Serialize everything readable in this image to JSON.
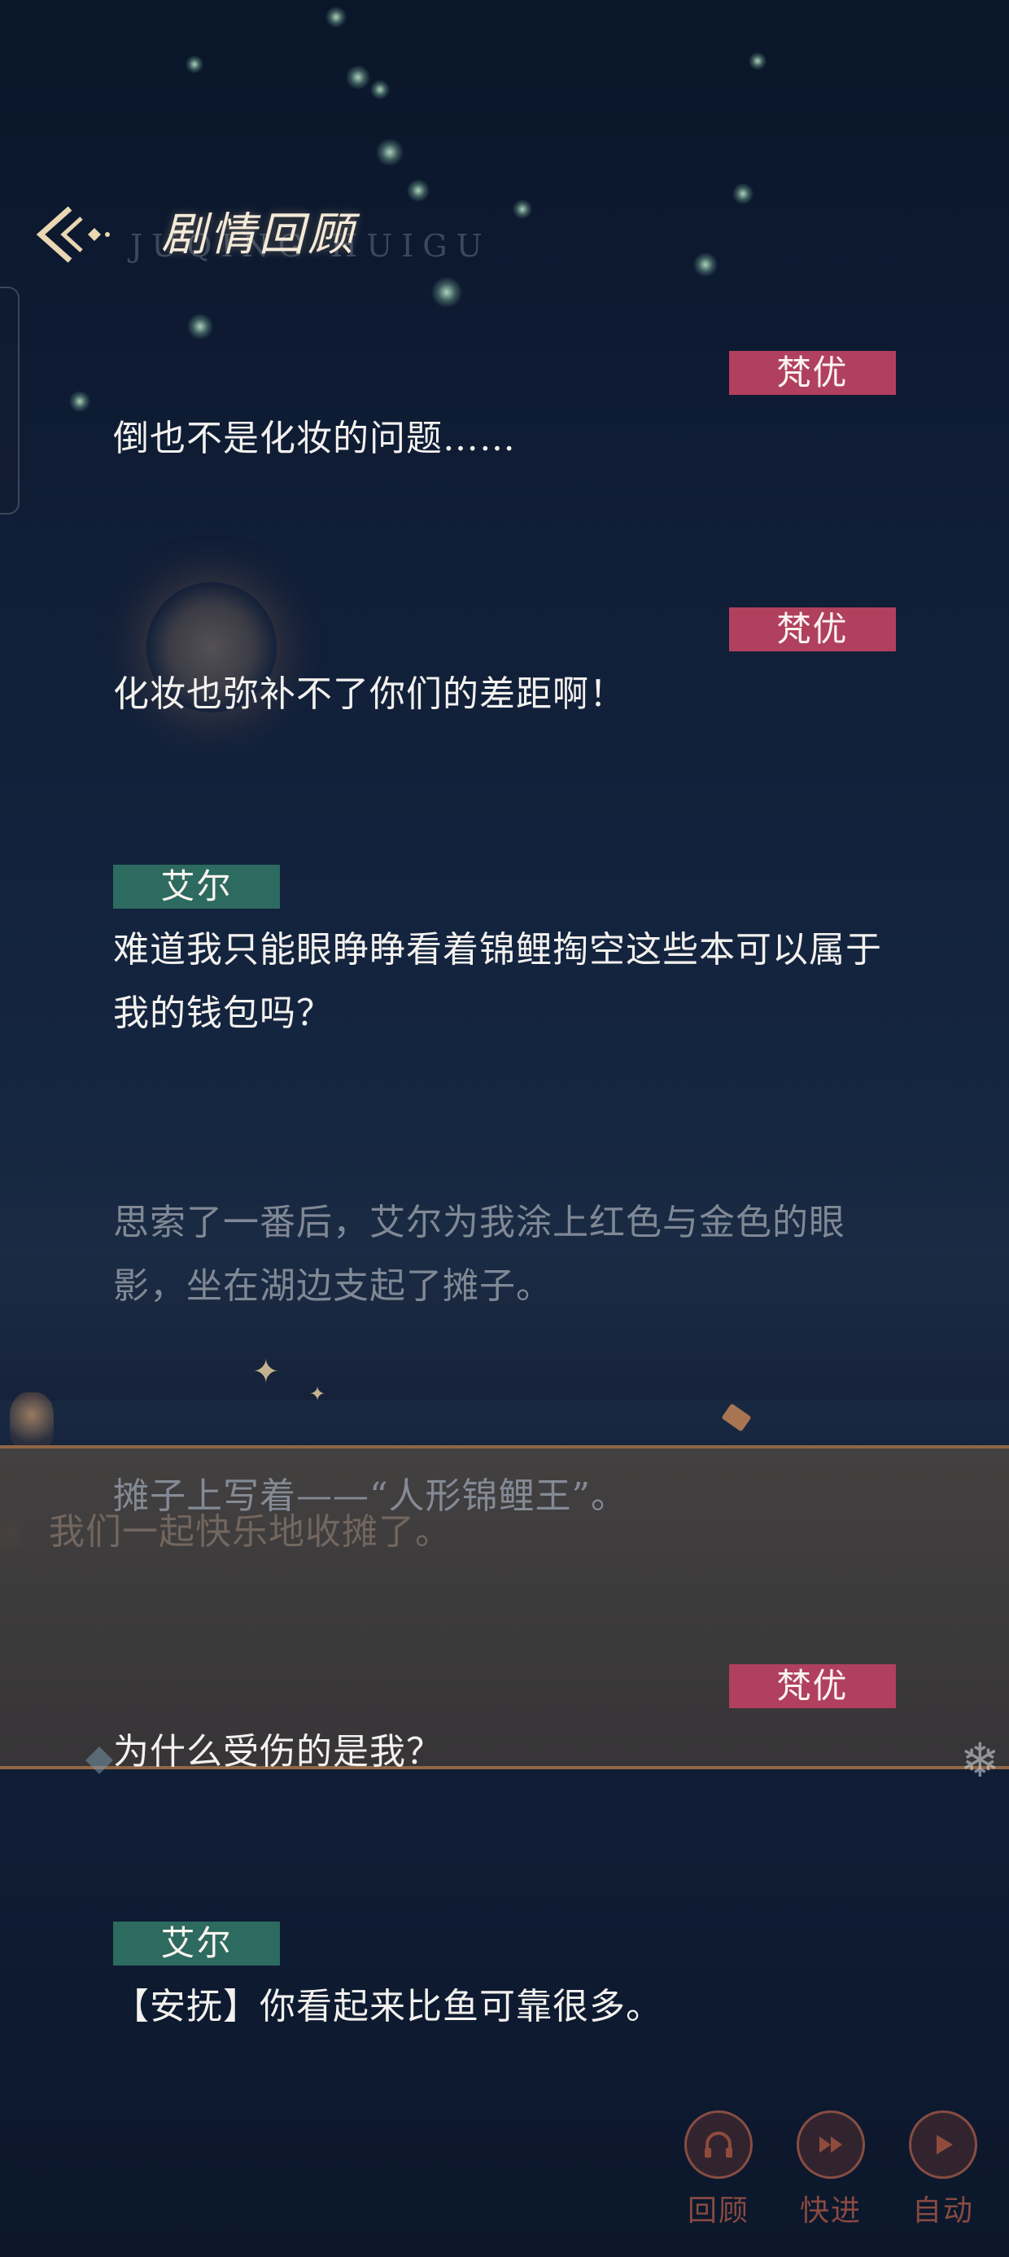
{
  "header": {
    "title": "剧情回顾",
    "subtitle": "JUQING HUIGU"
  },
  "background_overlay": {
    "text": "我们一起快乐地收摊了。"
  },
  "entries": [
    {
      "speaker": "梵优",
      "text": "倒也不是化妆的问题……"
    },
    {
      "speaker": "梵优",
      "text": "化妆也弥补不了你们的差距啊！"
    },
    {
      "speaker": "艾尔",
      "text": "难道我只能眼睁睁看着锦鲤掏空这些本可以属于我的钱包吗？"
    },
    {
      "speaker": "",
      "text": "思索了一番后，艾尔为我涂上红色与金色的眼影，坐在湖边支起了摊子。"
    },
    {
      "speaker": "",
      "text": "摊子上写着——“人形锦鲤王”。"
    },
    {
      "speaker": "梵优",
      "text": "为什么受伤的是我？"
    },
    {
      "speaker": "艾尔",
      "text": "【安抚】你看起来比鱼可靠很多。"
    }
  ],
  "controls": {
    "review": {
      "label": "回顾",
      "icon": "headphones-icon"
    },
    "skip": {
      "label": "快进",
      "icon": "fast-forward-icon"
    },
    "auto": {
      "label": "自动",
      "icon": "play-icon"
    }
  },
  "colors": {
    "fanyou_tag": "#b0405e",
    "aier_tag": "#2d6a60",
    "control_accent": "#965546"
  }
}
